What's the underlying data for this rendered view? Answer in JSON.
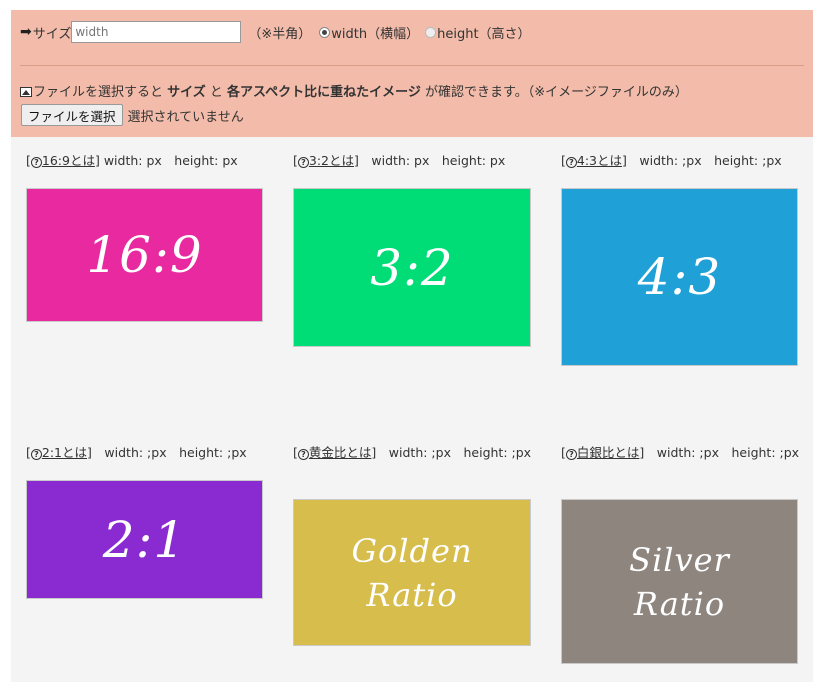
{
  "size_form": {
    "arrow_icon": "➡",
    "label": "サイズ",
    "input_placeholder": "width",
    "note": "（※半角）",
    "radio_width_label": "width（横幅）",
    "radio_height_label": "height（高さ）",
    "selected": "width"
  },
  "file_section": {
    "text_before": "ファイルを選択すると ",
    "strong_size": "サイズ",
    "text_and": " と ",
    "strong_aspect": "各アスペクト比に重ねたイメージ",
    "text_after": " が確認できます。（※イメージファイルのみ）",
    "button_label": "ファイルを選択",
    "status": "選択されていません"
  },
  "colors": {
    "header_bg": "#f3bcaa",
    "main_bg": "#f4f4f4"
  },
  "ratios": [
    {
      "bracket_open": "[",
      "link": "16:9とは",
      "bracket_close": "]",
      "info": " width: px　height: px",
      "label": "16:9",
      "color": "#e8299f"
    },
    {
      "bracket_open": "[",
      "link": "3:2とは",
      "bracket_close": "]",
      "info": "　width: px　height: px",
      "label": "3:2",
      "color": "#00dd77"
    },
    {
      "bracket_open": "[",
      "link": "4:3とは",
      "bracket_close": "]",
      "info": "　width: ;px　height: ;px",
      "label": "4:3",
      "color": "#1fa0d6"
    },
    {
      "bracket_open": "[",
      "link": "2:1とは",
      "bracket_close": "]",
      "info": "　width: ;px　height: ;px",
      "label": "2:1",
      "color": "#8a2bd2"
    },
    {
      "bracket_open": "[",
      "link": "黄金比とは",
      "bracket_close": "]",
      "info": "　width: ;px　height: ;px",
      "label_line1": "Golden",
      "label_line2": "Ratio",
      "color": "#d7bd4c"
    },
    {
      "bracket_open": "[",
      "link": "白銀比とは",
      "bracket_close": "]",
      "info": "　width: ;px　height: ;px",
      "label_line1": "Silver",
      "label_line2": "Ratio",
      "color": "#8e857f"
    }
  ]
}
